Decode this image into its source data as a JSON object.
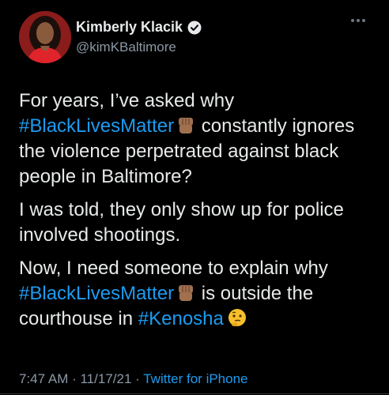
{
  "author": {
    "display_name": "Kimberly Klacik",
    "handle": "@kimKBaltimore",
    "verified": true
  },
  "tweet": {
    "p1_text_a": "For years, I’ve asked why",
    "p1_tag": "#BlackLivesMatter",
    "p1_emoji": "raised-fist-medium-dark-skin",
    "p1_text_b": "constantly ignores the violence perpetrated against black people in Baltimore?",
    "p2_text": "I was told, they only show up for police involved shootings.",
    "p3_text_a": "Now, I need someone to explain why",
    "p3_tag": "#BlackLivesMatter",
    "p3_emoji": "raised-fist-medium-dark-skin",
    "p3_text_b": "is outside the courthouse in",
    "p3_tag2": "#Kenosha",
    "p3_emoji2": "thinking-face"
  },
  "meta": {
    "time": "7:47 AM",
    "sep1": " · ",
    "date": "11/17/21",
    "sep2": " · ",
    "source": "Twitter for iPhone"
  },
  "colors": {
    "background": "#000000",
    "text": "#e7e9ea",
    "secondary": "#8b98a5",
    "link": "#1d9bf0"
  }
}
